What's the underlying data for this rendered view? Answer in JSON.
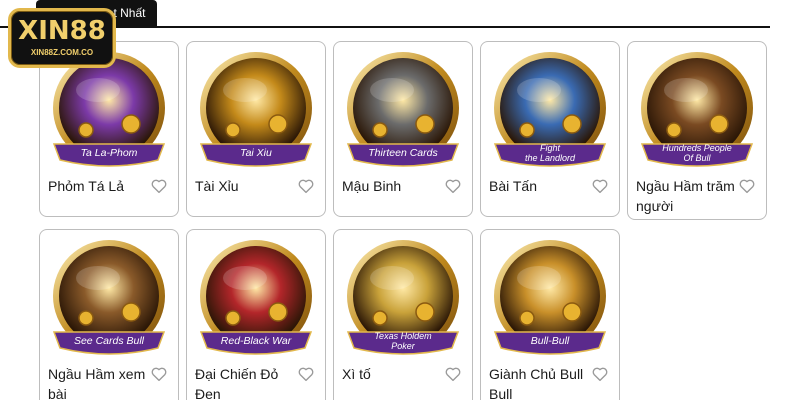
{
  "logo": {
    "brand": "XIN88",
    "domain": "XIN88Z.COM.CO"
  },
  "tab": {
    "label": "Trò Chơi Hot Nhất"
  },
  "colors": {
    "gold": "#e2b84c",
    "banner_purple": "#5b2a8c",
    "heart": "#9a9a9a"
  },
  "games": [
    {
      "name": "Phỏm Tá Lả",
      "banner": "Ta La-Phom",
      "banner2": "",
      "icon": "phom-game-icon",
      "hue": "#7c3aa8"
    },
    {
      "name": "Tài Xỉu",
      "banner": "Tai Xiu",
      "banner2": "",
      "icon": "tai-xiu-game-icon",
      "hue": "#c48a1a"
    },
    {
      "name": "Mậu Binh",
      "banner": "Thirteen Cards",
      "banner2": "",
      "icon": "thirteen-cards-game-icon",
      "hue": "#6b6b6b"
    },
    {
      "name": "Bài Tấn",
      "banner": "Fight",
      "banner2": "the Landlord",
      "icon": "fight-landlord-game-icon",
      "hue": "#3a6bb3"
    },
    {
      "name": "Ngầu Hầm trăm người",
      "banner": "Hundreds People",
      "banner2": "Of Bull",
      "icon": "hundreds-bull-game-icon",
      "hue": "#7a4a22"
    },
    {
      "name": "Ngầu Hầm xem bài",
      "banner": "See Cards Bull",
      "banner2": "",
      "icon": "see-cards-bull-game-icon",
      "hue": "#8a5a2a"
    },
    {
      "name": "Đại Chiến Đỏ Đen",
      "banner": "Red-Black War",
      "banner2": "",
      "icon": "red-black-war-game-icon",
      "hue": "#b3262a"
    },
    {
      "name": "Xì tố",
      "banner": "Texas Holdem",
      "banner2": "Poker",
      "icon": "texas-holdem-game-icon",
      "hue": "#c9a23a"
    },
    {
      "name": "Giành Chủ Bull Bull",
      "banner": "Bull-Bull",
      "banner2": "",
      "icon": "bull-bull-game-icon",
      "hue": "#c9902a"
    }
  ]
}
